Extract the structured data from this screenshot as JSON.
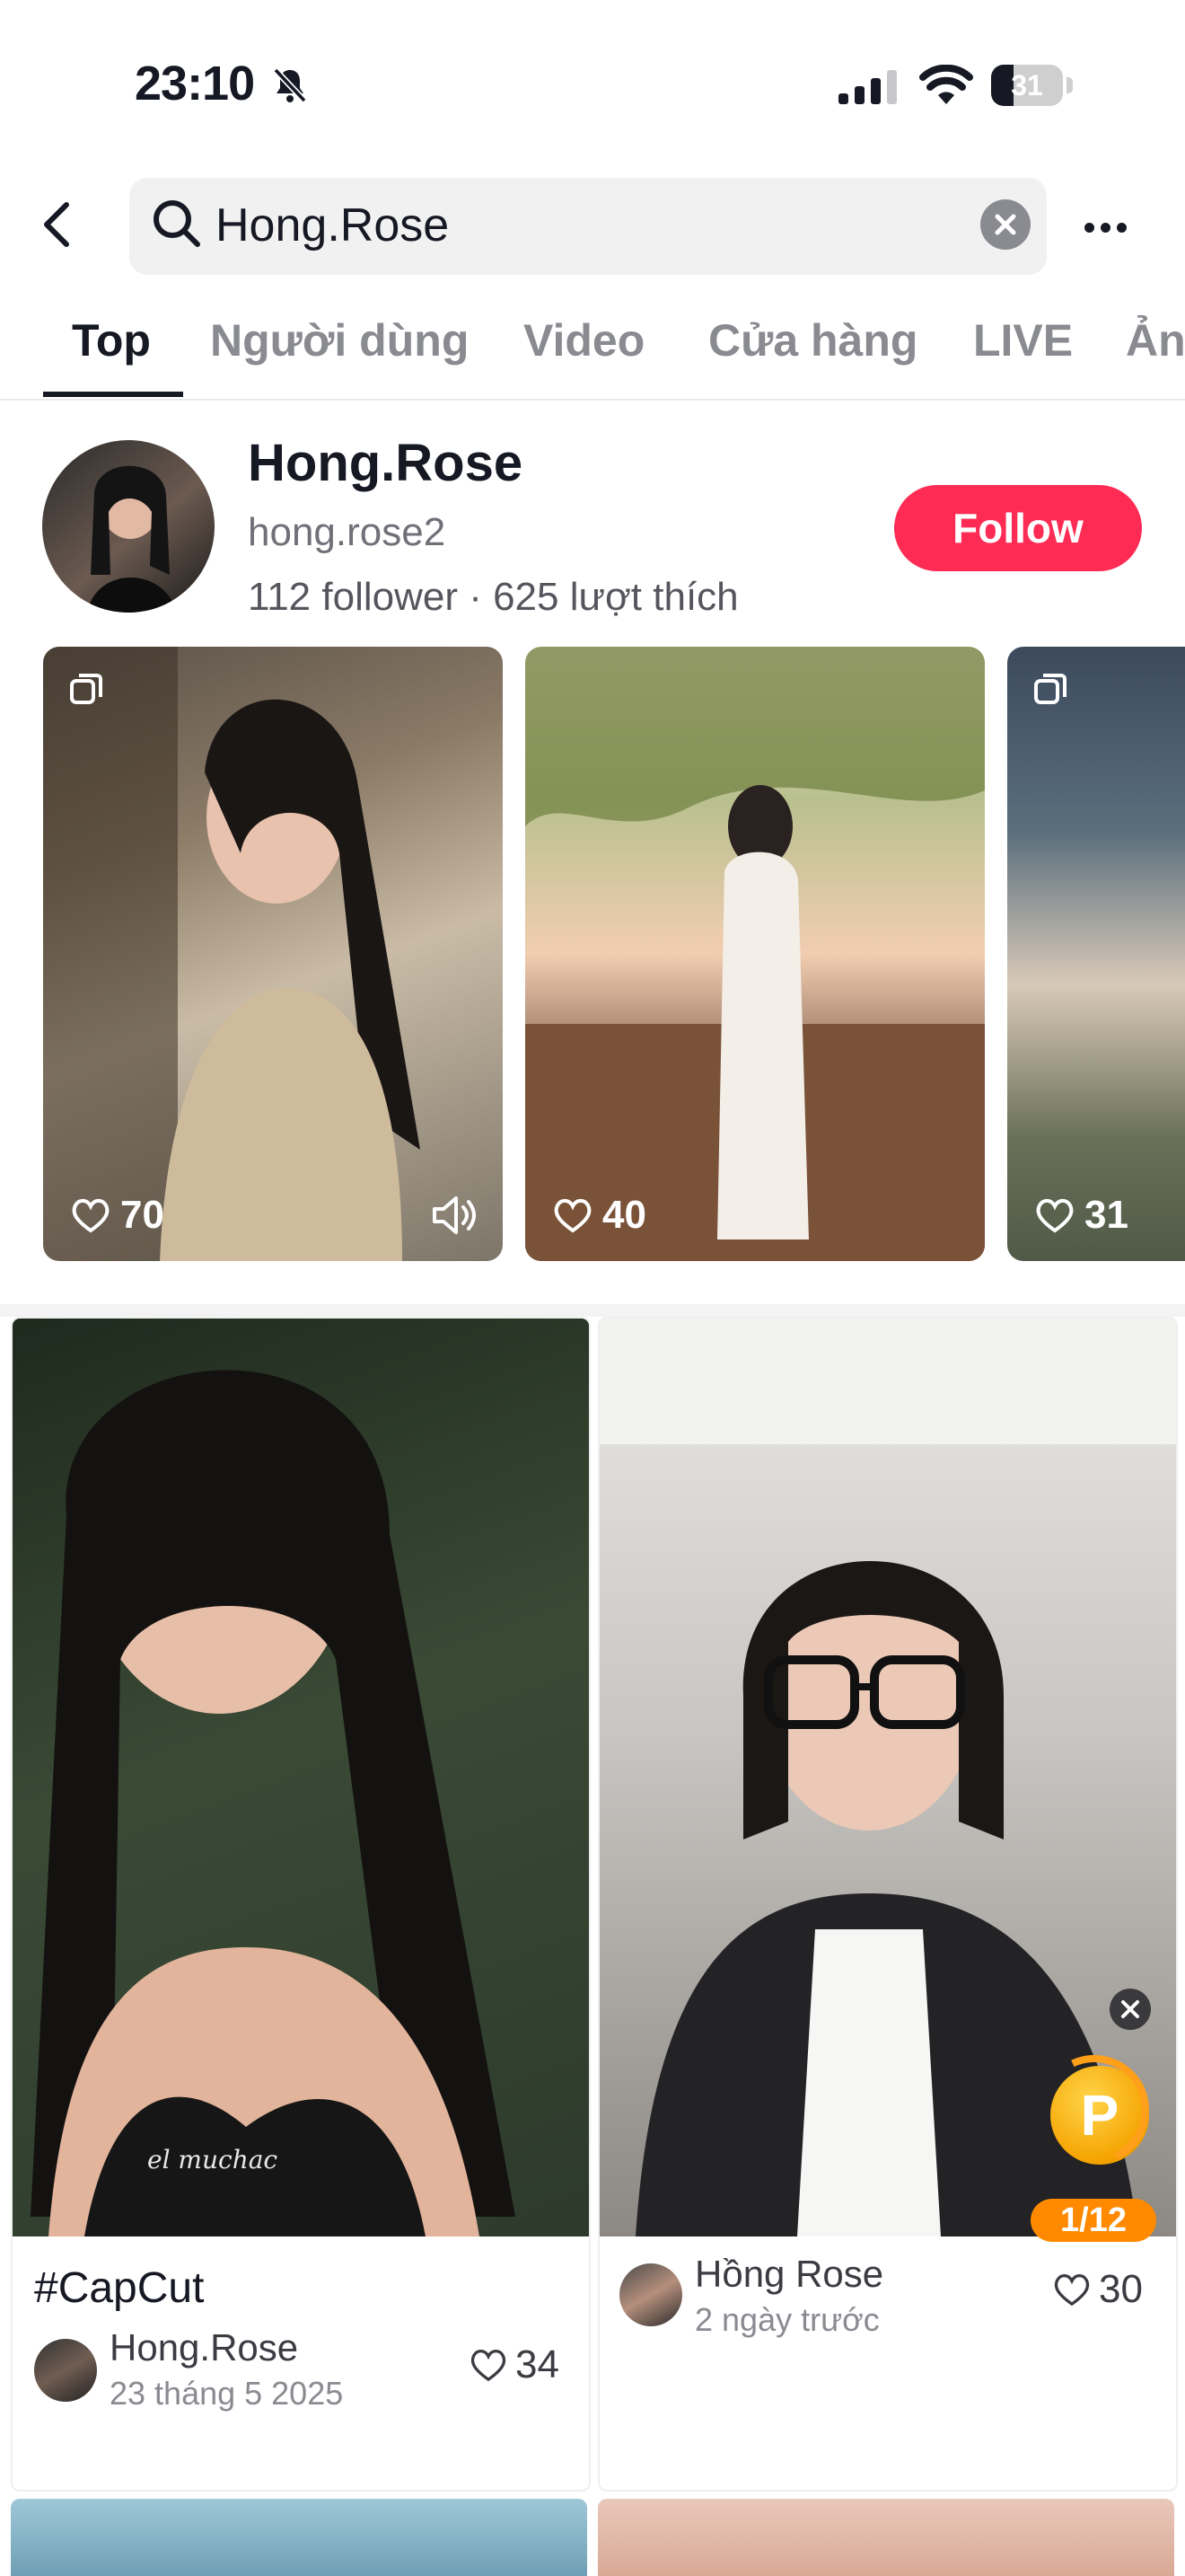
{
  "status_bar": {
    "time": "23:10",
    "battery": "31",
    "battery_level": 0.31
  },
  "search": {
    "query": "Hong.Rose"
  },
  "tabs": [
    {
      "label": "Top"
    },
    {
      "label": "Người dùng"
    },
    {
      "label": "Video"
    },
    {
      "label": "Cửa hàng"
    },
    {
      "label": "LIVE"
    },
    {
      "label": "Ản"
    }
  ],
  "user_card": {
    "name": "Hong.Rose",
    "handle": "hong.rose2",
    "stats": "112 follower · 625 lượt thích",
    "follow_label": "Follow"
  },
  "mini_videos": [
    {
      "likes": "70"
    },
    {
      "likes": "40"
    },
    {
      "likes": "31"
    }
  ],
  "feed": [
    {
      "caption": "#CapCut",
      "overlay_text": "el muchac",
      "author": "Hong.Rose",
      "date": "23 tháng 5 2025",
      "likes": "34"
    },
    {
      "author": "Hồng Rose",
      "date": "2 ngày trước",
      "likes": "30"
    }
  ],
  "coin_widget": {
    "letter": "P",
    "progress": "1/12"
  },
  "colors": {
    "accent": "#fe2c55",
    "coin": "#ff8a00"
  }
}
